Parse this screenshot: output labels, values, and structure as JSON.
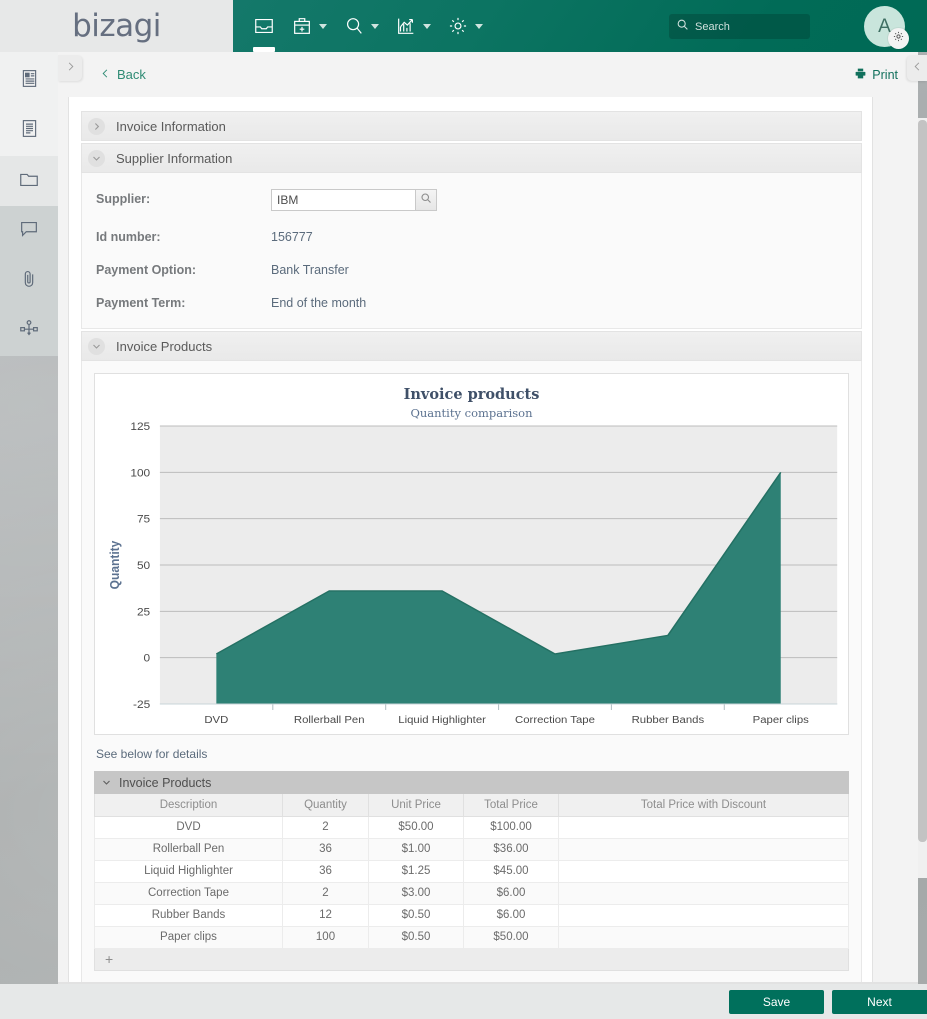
{
  "app": {
    "logo": "bizagi",
    "accent_teal": "#00705c",
    "link_green": "#2e8b74"
  },
  "topnav": {
    "items": [
      {
        "name": "inbox",
        "icon": "inbox-icon",
        "has_caret": false,
        "active": true
      },
      {
        "name": "new-case",
        "icon": "briefcase-plus-icon",
        "has_caret": true,
        "active": false
      },
      {
        "name": "search",
        "icon": "search-icon",
        "has_caret": true,
        "active": false
      },
      {
        "name": "analytics",
        "icon": "chart-icon",
        "has_caret": true,
        "active": false
      },
      {
        "name": "admin",
        "icon": "gear-icon",
        "has_caret": true,
        "active": false
      }
    ],
    "search": {
      "placeholder": "Search",
      "value": ""
    },
    "avatar_initial": "A"
  },
  "rail": {
    "items": [
      {
        "name": "form-icon",
        "label": "Form",
        "state": "lvl0"
      },
      {
        "name": "summary-icon",
        "label": "Summary",
        "state": "lvl0"
      },
      {
        "name": "folder-icon",
        "label": "Documents",
        "state": "lvl1"
      },
      {
        "name": "comment-icon",
        "label": "Comments",
        "state": "lvl2"
      },
      {
        "name": "paperclip-icon",
        "label": "Attachments",
        "state": "lvl2"
      },
      {
        "name": "process-icon",
        "label": "Process",
        "state": "lvl2"
      }
    ]
  },
  "actionbar": {
    "back_label": "Back",
    "print_label": "Print"
  },
  "sections": [
    {
      "title": "Invoice Information",
      "expanded": false
    },
    {
      "title": "Supplier Information",
      "expanded": true
    },
    {
      "title": "Invoice Products",
      "expanded": true
    }
  ],
  "supplier_form": {
    "supplier_label": "Supplier:",
    "supplier_value": "IBM",
    "id_label": "Id number:",
    "id_value": "156777",
    "payment_option_label": "Payment Option:",
    "payment_option_value": "Bank Transfer",
    "payment_term_label": "Payment Term:",
    "payment_term_value": "End of the month"
  },
  "note": "See below for details",
  "grid": {
    "title": "Invoice Products",
    "columns": [
      "Description",
      "Quantity",
      "Unit Price",
      "Total Price",
      "Total Price with Discount"
    ],
    "rows": [
      {
        "description": "DVD",
        "quantity": "2",
        "unit_price": "$50.00",
        "total_price": "$100.00",
        "total_with_discount": ""
      },
      {
        "description": "Rollerball Pen",
        "quantity": "36",
        "unit_price": "$1.00",
        "total_price": "$36.00",
        "total_with_discount": ""
      },
      {
        "description": "Liquid Highlighter",
        "quantity": "36",
        "unit_price": "$1.25",
        "total_price": "$45.00",
        "total_with_discount": ""
      },
      {
        "description": "Correction Tape",
        "quantity": "2",
        "unit_price": "$3.00",
        "total_price": "$6.00",
        "total_with_discount": ""
      },
      {
        "description": "Rubber Bands",
        "quantity": "12",
        "unit_price": "$0.50",
        "total_price": "$6.00",
        "total_with_discount": ""
      },
      {
        "description": "Paper clips",
        "quantity": "100",
        "unit_price": "$0.50",
        "total_price": "$50.00",
        "total_with_discount": ""
      }
    ],
    "add_row_label": "+"
  },
  "footer": {
    "save_label": "Save",
    "next_label": "Next"
  },
  "chart_data": {
    "type": "area",
    "title": "Invoice products",
    "subtitle": "Quantity comparison",
    "xlabel": "",
    "ylabel": "Quantity",
    "categories": [
      "DVD",
      "Rollerball Pen",
      "Liquid Highlighter",
      "Correction Tape",
      "Rubber Bands",
      "Paper clips"
    ],
    "values": [
      2,
      36,
      36,
      2,
      12,
      100
    ],
    "yticks": [
      125,
      100,
      75,
      50,
      25,
      0,
      -25
    ],
    "ylim": [
      -25,
      125
    ],
    "grid": true,
    "legend": "none",
    "series_color": "#2e8175",
    "plot_bg": "#ececec"
  }
}
